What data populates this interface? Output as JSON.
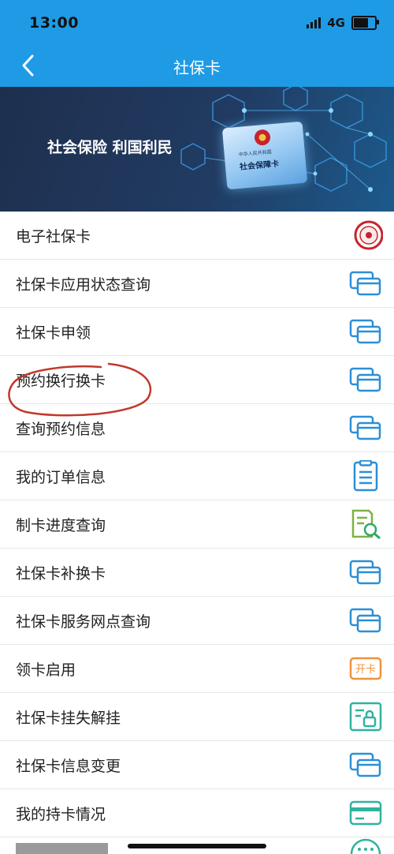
{
  "status_bar": {
    "time": "13:00",
    "network": "4G"
  },
  "nav": {
    "title": "社保卡"
  },
  "banner": {
    "slogan": "社会保险 利国利民",
    "card_small_text": "中华人民共和国",
    "card_title": "社会保障卡"
  },
  "menu": [
    {
      "label": "电子社保卡",
      "icon": "seal-icon"
    },
    {
      "label": "社保卡应用状态查询",
      "icon": "card-icon"
    },
    {
      "label": "社保卡申领",
      "icon": "card-icon"
    },
    {
      "label": "预约换行换卡",
      "icon": "card-icon"
    },
    {
      "label": "查询预约信息",
      "icon": "card-icon"
    },
    {
      "label": "我的订单信息",
      "icon": "clipboard-icon"
    },
    {
      "label": "制卡进度查询",
      "icon": "document-search-icon"
    },
    {
      "label": "社保卡补换卡",
      "icon": "card-icon"
    },
    {
      "label": "社保卡服务网点查询",
      "icon": "card-icon"
    },
    {
      "label": "领卡启用",
      "icon": "activate-card-icon",
      "icon_text": "开卡"
    },
    {
      "label": "社保卡挂失解挂",
      "icon": "lock-card-icon"
    },
    {
      "label": "社保卡信息变更",
      "icon": "card-icon"
    },
    {
      "label": "我的持卡情况",
      "icon": "credit-card-icon"
    }
  ],
  "colors": {
    "header": "#1f9be6",
    "icon_blue": "#2b8fd6",
    "icon_green": "#2fb39e",
    "icon_orange": "#f0913a",
    "annotation_red": "#c0392b"
  }
}
